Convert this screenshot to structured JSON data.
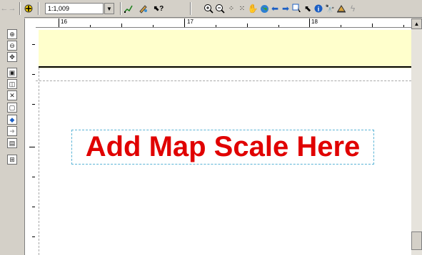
{
  "toolbar": {
    "scale_value": "1:1,009",
    "scale_dropdown_icon": "chevron-down-icon",
    "left_icons": [
      "back-arrow-icon",
      "forward-arrow-icon",
      "add-data-icon"
    ],
    "edit_icons": [
      "draw-icon",
      "pencil-icon",
      "whats-this-help-icon"
    ],
    "tools_icons": [
      "zoom-in-icon",
      "zoom-out-icon",
      "fixed-zoom-in-icon",
      "fixed-zoom-out-icon",
      "pan-icon",
      "full-extent-icon",
      "back-extent-icon",
      "forward-extent-icon",
      "select-features-icon",
      "select-elements-icon",
      "identify-icon",
      "find-icon",
      "measure-icon",
      "hyperlink-icon"
    ]
  },
  "layout_toolbar": {
    "icons": [
      "zoom-in-layout-icon",
      "zoom-out-layout-icon",
      "pan-layout-icon",
      "zoom-whole-page-icon",
      "zoom-100-icon",
      "fixed-zoom-in-layout-icon",
      "fixed-zoom-out-layout-icon",
      "go-back-extent-icon",
      "go-forward-extent-icon",
      "zoom-control-icon",
      "change-layout-icon"
    ]
  },
  "ruler": {
    "h_labels": [
      "16",
      "17",
      "18"
    ]
  },
  "canvas": {
    "scale_placeholder": "Add Map Scale Here",
    "panel_color": "#ffffcc",
    "text_color": "#e00000",
    "frame_color": "#5ab4d6"
  }
}
